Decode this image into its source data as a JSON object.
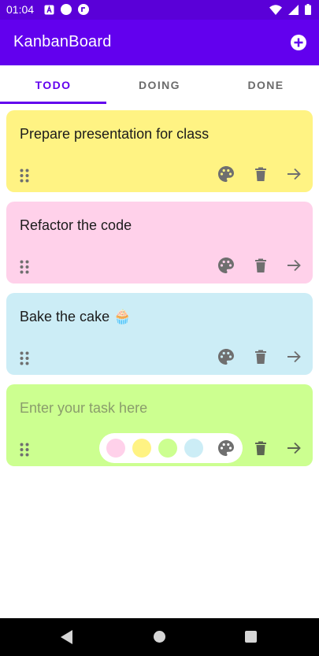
{
  "status_bar": {
    "time": "01:04",
    "icons": [
      "app-icon",
      "dot-icon",
      "sync-icon",
      "wifi-icon",
      "signal-icon",
      "battery-icon"
    ]
  },
  "app_bar": {
    "title": "KanbanBoard",
    "add_icon": "add-circle-icon"
  },
  "tabs": [
    {
      "label": "TODO",
      "active": true
    },
    {
      "label": "DOING",
      "active": false
    },
    {
      "label": "DONE",
      "active": false
    }
  ],
  "cards": [
    {
      "text": "Prepare presentation for class",
      "color": "#fff383"
    },
    {
      "text": "Refactor the code",
      "color": "#ffd1ea"
    },
    {
      "text": "Bake the cake 🧁",
      "color": "#ccedf6"
    }
  ],
  "new_card": {
    "placeholder": "Enter your task here",
    "color": "#ccff90",
    "swatches": [
      "#ffd1ea",
      "#fff383",
      "#ccff90",
      "#ccedf6"
    ]
  },
  "colors": {
    "primary": "#6200ee",
    "status_bar": "#5a00d8",
    "icon": "#6f6f6f"
  },
  "nav_bar": {
    "icons": [
      "back-icon",
      "home-icon",
      "recents-icon"
    ]
  }
}
